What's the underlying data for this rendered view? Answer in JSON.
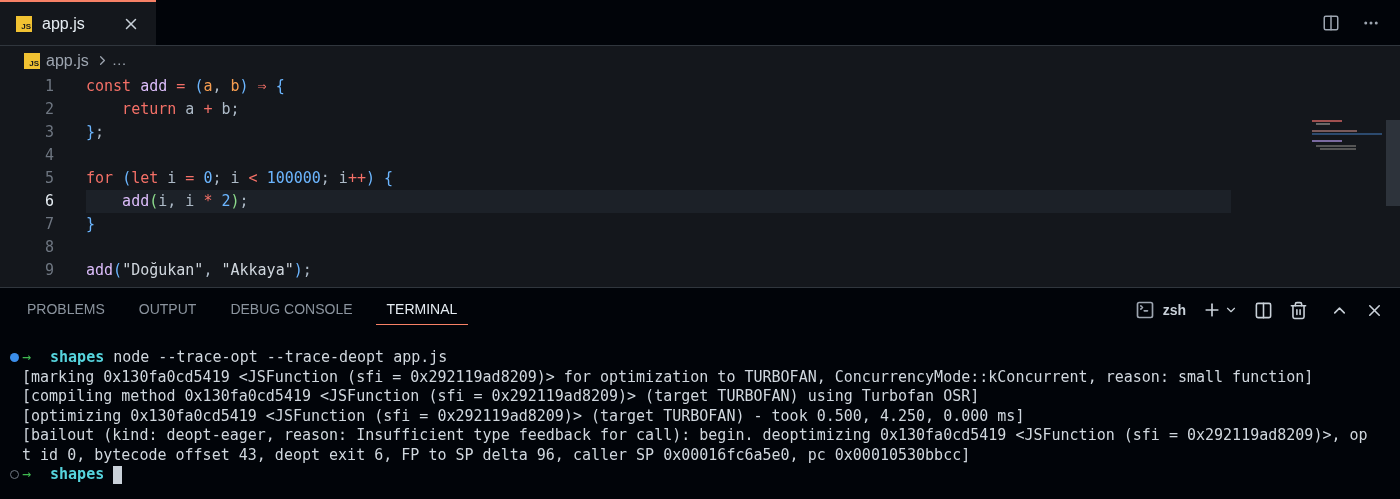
{
  "editor_tabs": [
    {
      "icon_text": "JS",
      "label": "app.js",
      "selected": true
    }
  ],
  "breadcrumb": {
    "icon_text": "JS",
    "file": "app.js",
    "more": "…"
  },
  "code_lines": [
    {
      "number": "1",
      "current": false,
      "tokens": [
        {
          "kind": "keyword",
          "text": "const "
        },
        {
          "kind": "function",
          "text": "add"
        },
        {
          "kind": "operator",
          "text": " = "
        },
        {
          "kind": "bracket",
          "text": "("
        },
        {
          "kind": "param",
          "text": "a"
        },
        {
          "kind": "plain",
          "text": ", "
        },
        {
          "kind": "param",
          "text": "b"
        },
        {
          "kind": "bracket",
          "text": ")"
        },
        {
          "kind": "operator",
          "text": " ⇒ "
        },
        {
          "kind": "bracket",
          "text": "{"
        }
      ]
    },
    {
      "number": "2",
      "current": false,
      "tokens": [
        {
          "kind": "keyword",
          "text": "    return"
        },
        {
          "kind": "plain",
          "text": " a "
        },
        {
          "kind": "operator",
          "text": "+"
        },
        {
          "kind": "plain",
          "text": " b;"
        }
      ]
    },
    {
      "number": "3",
      "current": false,
      "tokens": [
        {
          "kind": "bracket",
          "text": "}"
        },
        {
          "kind": "plain",
          "text": ";"
        }
      ]
    },
    {
      "number": "4",
      "current": false
    },
    {
      "number": "5",
      "current": false,
      "tokens": [
        {
          "kind": "keyword",
          "text": "for "
        },
        {
          "kind": "bracket",
          "text": "("
        },
        {
          "kind": "keyword",
          "text": "let"
        },
        {
          "kind": "plain",
          "text": " i "
        },
        {
          "kind": "operator",
          "text": "= "
        },
        {
          "kind": "number",
          "text": "0"
        },
        {
          "kind": "plain",
          "text": "; i "
        },
        {
          "kind": "operator",
          "text": "< "
        },
        {
          "kind": "number",
          "text": "100000"
        },
        {
          "kind": "plain",
          "text": "; i"
        },
        {
          "kind": "operator",
          "text": "++"
        },
        {
          "kind": "bracket",
          "text": ") {"
        }
      ]
    },
    {
      "number": "6",
      "current": true,
      "tokens": [
        {
          "kind": "function",
          "text": "    add"
        },
        {
          "kind": "bracket2",
          "text": "("
        },
        {
          "kind": "plain",
          "text": "i, i "
        },
        {
          "kind": "operator",
          "text": "* "
        },
        {
          "kind": "number",
          "text": "2"
        },
        {
          "kind": "bracket2",
          "text": ")"
        },
        {
          "kind": "plain",
          "text": ";"
        }
      ]
    },
    {
      "number": "7",
      "current": false,
      "tokens": [
        {
          "kind": "bracket",
          "text": "}"
        }
      ]
    },
    {
      "number": "8",
      "current": false
    },
    {
      "number": "9",
      "current": false,
      "tokens": [
        {
          "kind": "function",
          "text": "add"
        },
        {
          "kind": "bracket",
          "text": "("
        },
        {
          "kind": "string",
          "text": "\"Doğukan\""
        },
        {
          "kind": "plain",
          "text": ", "
        },
        {
          "kind": "string",
          "text": "\"Akkaya\""
        },
        {
          "kind": "bracket",
          "text": ")"
        },
        {
          "kind": "plain",
          "text": ";"
        }
      ]
    }
  ],
  "panel_tabs": [
    {
      "label": "PROBLEMS",
      "selected": false
    },
    {
      "label": "OUTPUT",
      "selected": false
    },
    {
      "label": "DEBUG CONSOLE",
      "selected": false
    },
    {
      "label": "TERMINAL",
      "selected": true
    }
  ],
  "terminal_profile": "zsh",
  "terminal_lines": [
    {
      "kind": "prompt",
      "done": true,
      "arrow": "→",
      "dir": "shapes",
      "command": "node --trace-opt --trace-deopt app.js"
    },
    {
      "kind": "output",
      "text": "[marking 0x130fa0cd5419 <JSFunction (sfi = 0x292119ad8209)> for optimization to TURBOFAN, ConcurrencyMode::kConcurrent, reason: small function]"
    },
    {
      "kind": "output",
      "text": "[compiling method 0x130fa0cd5419 <JSFunction (sfi = 0x292119ad8209)> (target TURBOFAN) using Turbofan OSR]"
    },
    {
      "kind": "output",
      "text": "[optimizing 0x130fa0cd5419 <JSFunction (sfi = 0x292119ad8209)> (target TURBOFAN) - took 0.500, 4.250, 0.000 ms]"
    },
    {
      "kind": "output",
      "text": "[bailout (kind: deopt-eager, reason: Insufficient type feedback for call): begin. deoptimizing 0x130fa0cd5419 <JSFunction (sfi = 0x292119ad8209)>, op"
    },
    {
      "kind": "output",
      "text": "t id 0, bytecode offset 43, deopt exit 6, FP to SP delta 96, caller SP 0x00016fc6a5e0, pc 0x00010530bbcc]"
    },
    {
      "kind": "prompt",
      "done": false,
      "arrow": "→",
      "dir": "shapes"
    }
  ]
}
